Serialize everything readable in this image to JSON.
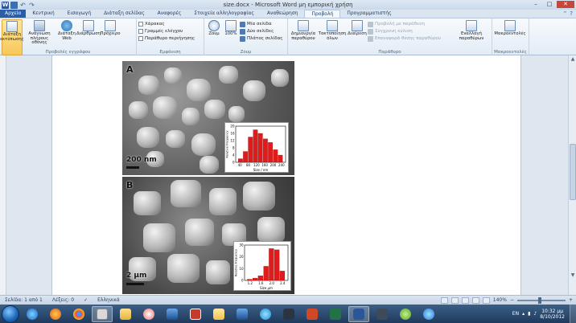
{
  "window": {
    "title": "size.docx  -  Microsoft Word μη εμπορική χρήση",
    "controls": {
      "minimize": "–",
      "maximize": "□",
      "close": "✕"
    }
  },
  "tabs": [
    {
      "label": "Αρχείο",
      "kind": "file"
    },
    {
      "label": "Κεντρική"
    },
    {
      "label": "Εισαγωγή"
    },
    {
      "label": "Διάταξη σελίδας"
    },
    {
      "label": "Αναφορές"
    },
    {
      "label": "Στοιχεία αλληλογραφίας"
    },
    {
      "label": "Αναθεώρηση"
    },
    {
      "label": "Προβολή",
      "kind": "active"
    },
    {
      "label": "Προγραμματιστής"
    }
  ],
  "ribbon": {
    "doc_views": {
      "label": "Προβολές εγγράφου",
      "buttons": [
        {
          "label": "Διάταξη εκτύπωσης"
        },
        {
          "label": "Ανάγνωση πλήρους οθόνης"
        },
        {
          "label": "Διάταξη Web"
        },
        {
          "label": "Διάρθρωση"
        },
        {
          "label": "Πρόχειρο"
        }
      ]
    },
    "show": {
      "label": "Εμφάνιση",
      "items": [
        "Χάρακας",
        "Γραμμές ελέγχου",
        "Παράθυρο περιήγησης"
      ]
    },
    "zoom": {
      "label": "Ζουμ",
      "zoom_button": "Ζουμ",
      "hundred": "100%",
      "options": [
        "Μία σελίδα",
        "Δύο σελίδες",
        "Πλάτος σελίδας"
      ]
    },
    "window": {
      "label": "Παράθυρο",
      "buttons": [
        "Δημιουργία παραθύρου",
        "Τακτοποίηση όλων",
        "Διαίρεση"
      ],
      "side": [
        "Προβολή με παράθεση",
        "Σύγχρονη κύλιση",
        "Επαναφορά θέσης παραθύρου"
      ],
      "switch": "Εναλλαγή παραθύρων"
    },
    "macros": {
      "label": "Μακροεντολές",
      "button": "Μακροεντολές"
    }
  },
  "figure": {
    "panel_a": {
      "label": "A",
      "scale": "200 nm"
    },
    "panel_b": {
      "label": "B",
      "scale": "2 μm"
    }
  },
  "chart_data": [
    {
      "type": "bar",
      "ylabel": "Relative Frequency",
      "xlabel": "Size / nm",
      "categories": [
        80,
        100,
        120,
        140,
        160,
        180,
        200,
        220,
        240
      ],
      "values": [
        2,
        6,
        14,
        18,
        16,
        13,
        11,
        7,
        4
      ],
      "ylim": [
        0,
        20
      ],
      "yticks": [
        0,
        4,
        8,
        12,
        16,
        20
      ],
      "xticks": [
        "40",
        "80",
        "120",
        "160",
        "200",
        "240"
      ],
      "bar_color": "#e01b1b"
    },
    {
      "type": "bar",
      "ylabel": "Relative Frequency",
      "xlabel": "Size μm",
      "categories": [
        1.2,
        1.4,
        1.6,
        1.8,
        2.0,
        2.2,
        2.4
      ],
      "values": [
        1,
        2,
        4,
        12,
        27,
        26,
        8
      ],
      "ylim": [
        0,
        30
      ],
      "yticks": [
        0,
        10,
        20,
        30
      ],
      "xticks": [
        "1.2",
        "1.6",
        "2.0",
        "2.4"
      ],
      "bar_color": "#e01b1b"
    }
  ],
  "statusbar": {
    "page": "Σελίδα: 1 από 1",
    "words": "Λέξεις: 0",
    "language": "Ελληνικά",
    "zoom": "140%"
  },
  "taskbar": {
    "language": "EN",
    "time": "10:32 μμ",
    "date": "8/10/2012"
  }
}
